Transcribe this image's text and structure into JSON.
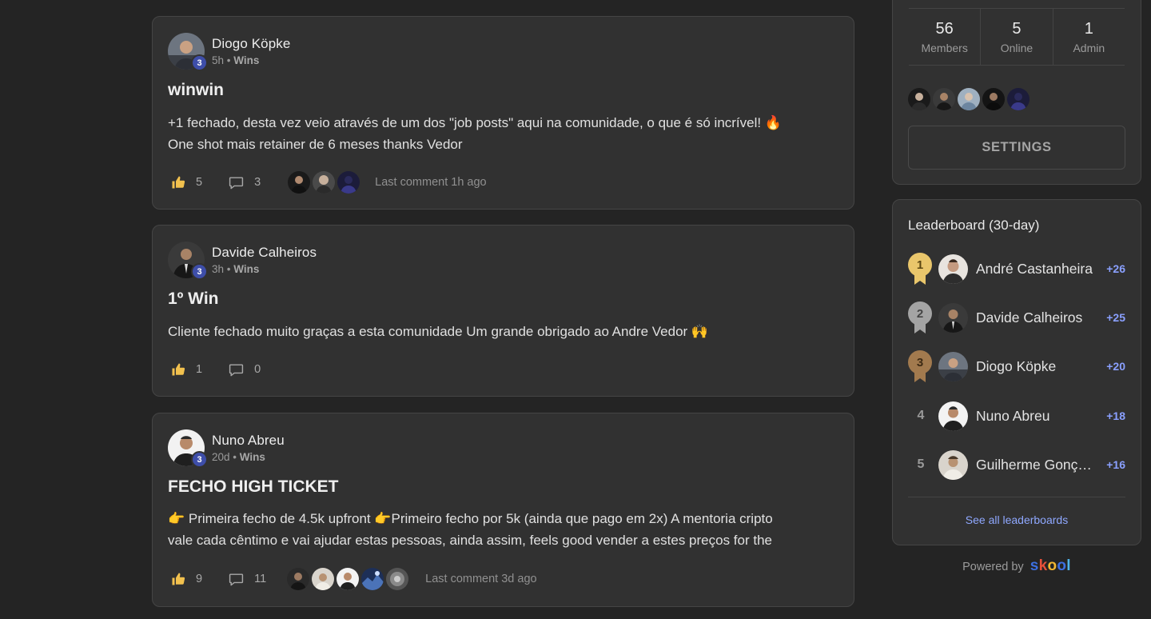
{
  "posts": [
    {
      "author": "Diogo Köpke",
      "level": "3",
      "time": "5h",
      "category": "Wins",
      "title": "winwin",
      "body_lines": [
        "+1 fechado, desta vez veio através de um dos \"job posts\" aqui na comunidade, o que é só incrível! 🔥",
        "One shot mais retainer de 6 meses thanks Vedor"
      ],
      "likes": "5",
      "comments": "3",
      "last_comment": "Last comment 1h ago"
    },
    {
      "author": "Davide Calheiros",
      "level": "3",
      "time": "3h",
      "category": "Wins",
      "title": "1º Win",
      "body_lines": [
        "Cliente fechado muito graças a esta comunidade Um grande obrigado ao Andre Vedor 🙌"
      ],
      "likes": "1",
      "comments": "0",
      "last_comment": ""
    },
    {
      "author": "Nuno Abreu",
      "level": "3",
      "time": "20d",
      "category": "Wins",
      "title": "FECHO HIGH TICKET",
      "body_lines": [
        "👉 Primeira fecho de 4.5k upfront 👉Primeiro fecho por 5k (ainda que pago em 2x) A mentoria cripto",
        "vale cada cêntimo e vai ajudar estas pessoas, ainda assim, feels good vender a estes preços for the"
      ],
      "likes": "9",
      "comments": "11",
      "last_comment": "Last comment 3d ago"
    }
  ],
  "community": {
    "members": "56",
    "members_label": "Members",
    "online": "5",
    "online_label": "Online",
    "admin": "1",
    "admin_label": "Admin",
    "settings_label": "SETTINGS"
  },
  "leaderboard": {
    "title": "Leaderboard (30-day)",
    "entries": [
      {
        "rank": "1",
        "name": "André Castanheira",
        "points": "+26"
      },
      {
        "rank": "2",
        "name": "Davide Calheiros",
        "points": "+25"
      },
      {
        "rank": "3",
        "name": "Diogo Köpke",
        "points": "+20"
      },
      {
        "rank": "4",
        "name": "Nuno Abreu",
        "points": "+18"
      },
      {
        "rank": "5",
        "name": "Guilherme Gonç…",
        "points": "+16"
      }
    ],
    "see_all": "See all leaderboards"
  },
  "footer": {
    "powered_by": "Powered by",
    "brand": "skool"
  },
  "colors": {
    "gold": "#e9c66b",
    "silver": "#a4a4a4",
    "bronze": "#a27a4e",
    "accent": "#8fa8ff"
  }
}
